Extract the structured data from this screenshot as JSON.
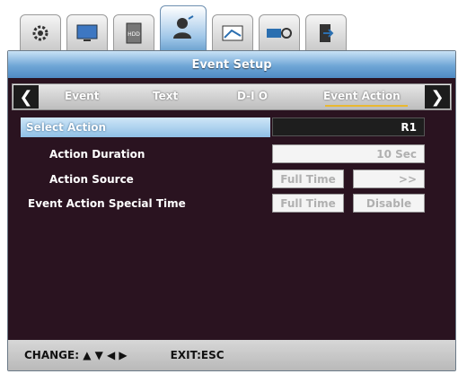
{
  "tabs": [
    {
      "icon": "gear-icon",
      "active": false
    },
    {
      "icon": "monitor-icon",
      "active": false
    },
    {
      "icon": "hdd-icon",
      "label": "HDD",
      "active": false
    },
    {
      "icon": "user-icon",
      "active": true
    },
    {
      "icon": "display-settings-icon",
      "active": false
    },
    {
      "icon": "network-icon",
      "active": false
    },
    {
      "icon": "exit-door-icon",
      "active": false
    }
  ],
  "window": {
    "title": "Event Setup"
  },
  "subtabs": {
    "items": [
      "Event",
      "Text",
      "D-I O",
      "Event Action"
    ],
    "active": "Event Action"
  },
  "rows": {
    "select_action": {
      "label": "Select Action",
      "value": "R1"
    },
    "action_duration": {
      "label": "Action Duration",
      "value": "10 Sec"
    },
    "action_source": {
      "label": "Action Source",
      "value1": "Full Time",
      "value2": ">>"
    },
    "special_time": {
      "label": "Event Action Special Time",
      "value1": "Full Time",
      "value2": "Disable"
    }
  },
  "footer": {
    "change": "CHANGE: ▲ ▼ ◀ ▶",
    "exit": "EXIT:ESC"
  },
  "colors": {
    "accent": "#6fa6d6",
    "background": "#2a1320",
    "highlight": "#8fc0e6",
    "underline": "#e9b830"
  }
}
